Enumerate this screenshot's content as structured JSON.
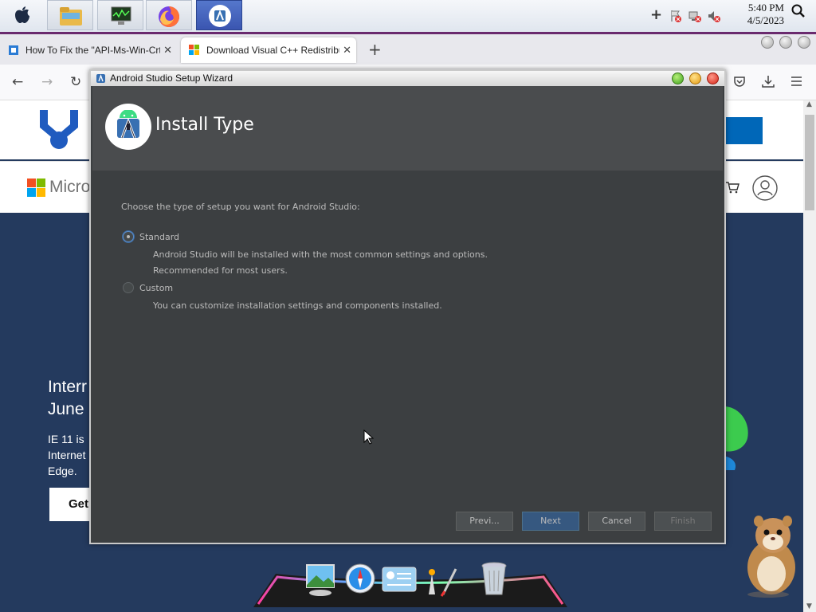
{
  "taskbar": {
    "apps": [
      {
        "icon": "apple-menu-icon"
      },
      {
        "icon": "file-explorer-icon"
      },
      {
        "icon": "system-monitor-icon"
      },
      {
        "icon": "firefox-icon"
      },
      {
        "icon": "android-studio-icon",
        "active": true
      }
    ],
    "clock_time": "5:40 PM",
    "clock_date": "4/5/2023"
  },
  "browser": {
    "tabs": [
      {
        "label": "How To Fix the \"API-Ms-Win-Crt-R",
        "active": false
      },
      {
        "label": "Download Visual C++ Redistribu",
        "active": true
      }
    ],
    "new_tab": "+"
  },
  "page": {
    "logo_text": "Micro",
    "heading_line1": "Interr",
    "heading_line2": "June",
    "body_line1": "IE 11 is",
    "body_line2": "Internet",
    "body_line3": "Edge.",
    "cta_label": "Get"
  },
  "wizard": {
    "window_title": "Android Studio Setup Wizard",
    "heading": "Install Type",
    "prompt": "Choose the type of setup you want for Android Studio:",
    "options": [
      {
        "label": "Standard",
        "selected": true,
        "description": [
          "Android Studio will be installed with the most common settings and options.",
          "Recommended for most users."
        ]
      },
      {
        "label": "Custom",
        "selected": false,
        "description": [
          "You can customize installation settings and components installed."
        ]
      }
    ],
    "buttons": {
      "previous": "Previ...",
      "next": "Next",
      "cancel": "Cancel",
      "finish": "Finish"
    }
  },
  "colors": {
    "wizard_bg": "#3c3f41",
    "wizard_header": "#4a4c4e",
    "primary_button": "#365880",
    "page_background": "#243a5e"
  }
}
